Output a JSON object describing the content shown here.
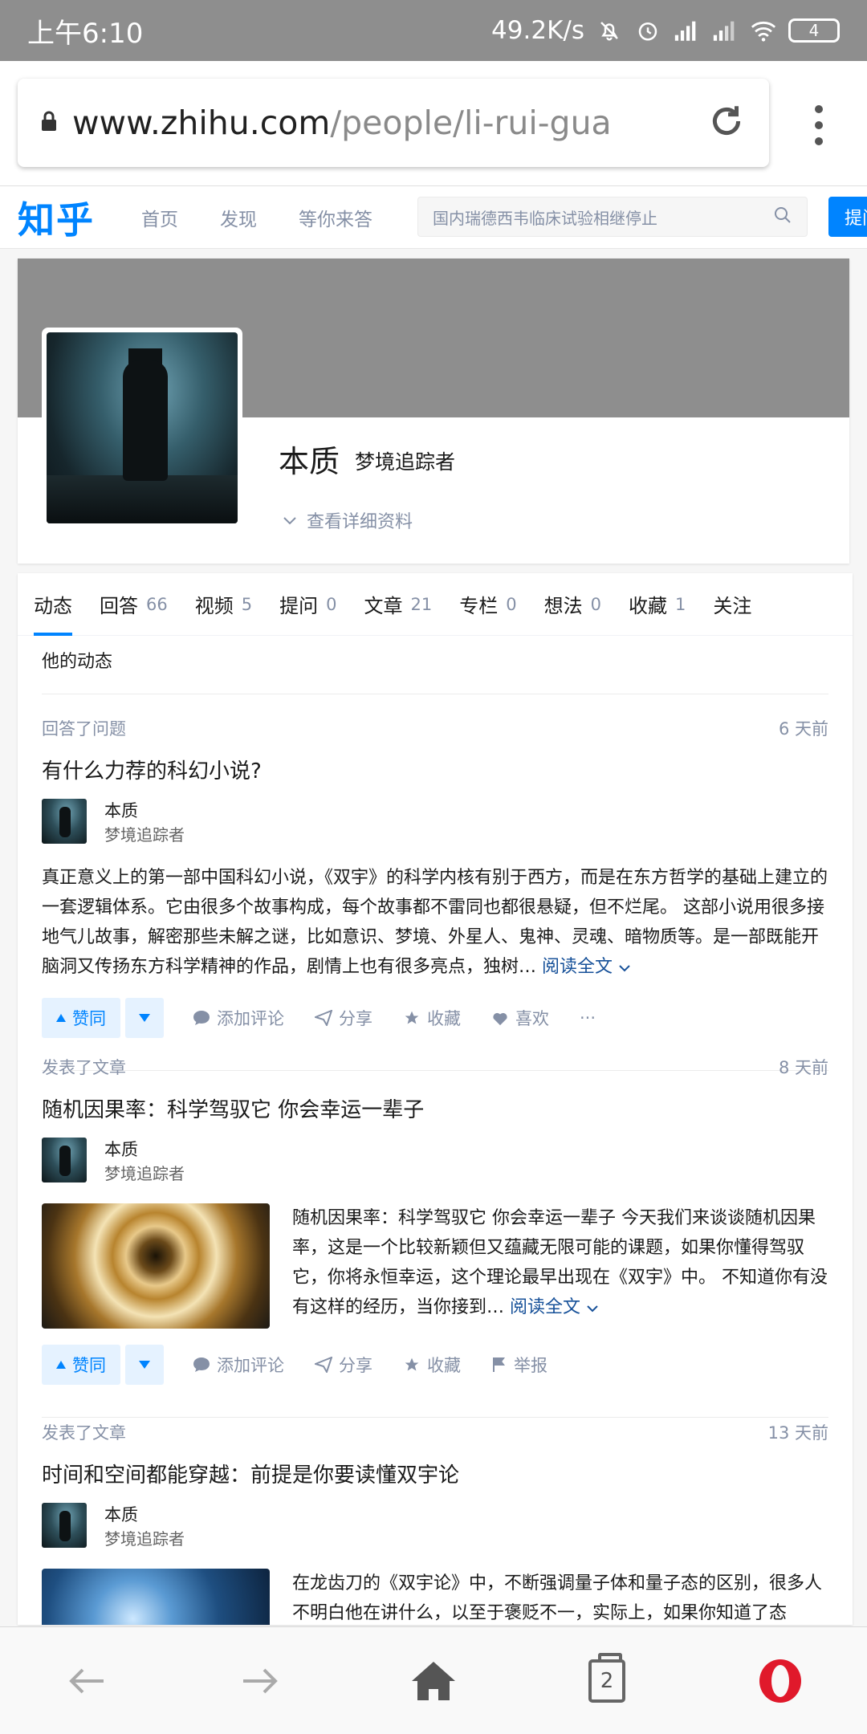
{
  "status_bar": {
    "time": "上午6:10",
    "speed": "49.2K/s",
    "battery": "4"
  },
  "browser": {
    "url_host": "www.zhihu.com",
    "url_path": "/people/li-rui-gua",
    "tab_count": "2"
  },
  "zhihu_nav": {
    "logo": "知乎",
    "links": [
      "首页",
      "发现",
      "等你来答"
    ],
    "search_placeholder": "国内瑞德西韦临床试验相继停止",
    "ask_button": "提问"
  },
  "profile": {
    "name": "本质",
    "headline": "梦境追踪者",
    "detail_link": "查看详细资料"
  },
  "tabs": [
    {
      "label": "动态",
      "count": ""
    },
    {
      "label": "回答",
      "count": "66"
    },
    {
      "label": "视频",
      "count": "5"
    },
    {
      "label": "提问",
      "count": "0"
    },
    {
      "label": "文章",
      "count": "21"
    },
    {
      "label": "专栏",
      "count": "0"
    },
    {
      "label": "想法",
      "count": "0"
    },
    {
      "label": "收藏",
      "count": "1"
    },
    {
      "label": "关注",
      "count": ""
    }
  ],
  "feed": {
    "section_title": "他的动态",
    "items": [
      {
        "meta": "回答了问题",
        "time": "6 天前",
        "title": "有什么力荐的科幻小说?",
        "author_name": "本质",
        "author_headline": "梦境追踪者",
        "excerpt": "真正意义上的第一部中国科幻小说，《双宇》的科学内核有别于西方，而是在东方哲学的基础上建立的一套逻辑体系。它由很多个故事构成，每个故事都不雷同也都很悬疑，但不烂尾。 这部小说用很多接地气儿故事，解密那些未解之谜，比如意识、梦境、外星人、鬼神、灵魂、暗物质等。是一部既能开脑洞又传扬东方科学精神的作品，剧情上也有很多亮点，独树… ",
        "read_more": "阅读全文",
        "actions": [
          "赞同",
          "添加评论",
          "分享",
          "收藏",
          "喜欢",
          "···"
        ]
      },
      {
        "meta": "发表了文章",
        "time": "8 天前",
        "title": "随机因果率：科学驾驭它 你会幸运一辈子",
        "author_name": "本质",
        "author_headline": "梦境追踪者",
        "excerpt": "随机因果率：科学驾驭它 你会幸运一辈子 今天我们来谈谈随机因果率，这是一个比较新颖但又蕴藏无限可能的课题，如果你懂得驾驭它，你将永恒幸运，这个理论最早出现在《双宇》中。 不知道你有没有这样的经历，当你接到… ",
        "read_more": "阅读全文",
        "actions": [
          "赞同",
          "添加评论",
          "分享",
          "收藏",
          "举报"
        ]
      },
      {
        "meta": "发表了文章",
        "time": "13 天前",
        "title": "时间和空间都能穿越：前提是你要读懂双宇论",
        "author_name": "本质",
        "author_headline": "梦境追踪者",
        "excerpt": "在龙齿刀的《双宇论》中，不断强调量子体和量子态的区别，很多人不明白他在讲什么，以至于褒贬不一，实际上，如果你知道了态"
      }
    ]
  }
}
